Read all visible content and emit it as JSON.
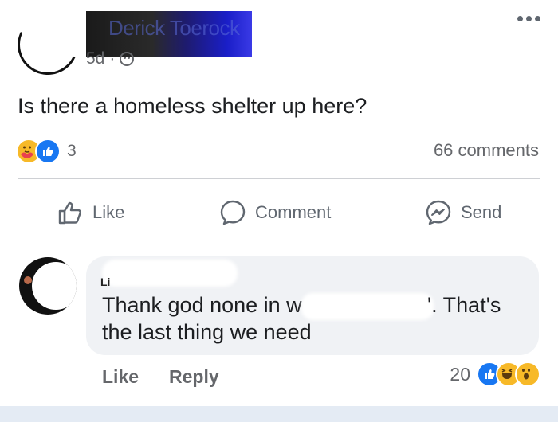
{
  "post": {
    "author": "Derick Toerock",
    "time": "5d",
    "separator": "·",
    "text": "Is there a homeless shelter up here?",
    "reaction_count": "3",
    "comments_label": "66 comments"
  },
  "actions": {
    "like": "Like",
    "comment": "Comment",
    "send": "Send"
  },
  "comment": {
    "author_visible": "Li",
    "text_part1": "Thank god none in w",
    "text_part2": "'. That's",
    "text_line2": "the last thing we need",
    "like_label": "Like",
    "reply_label": "Reply",
    "reaction_count": "20"
  },
  "colors": {
    "like_blue": "#1877f2",
    "emoji_yellow": "#f7b928",
    "muted_text": "#65676b",
    "bubble_bg": "#f0f2f5"
  },
  "icons": {
    "post_reactions": [
      "care-emoji-icon",
      "like-reaction-icon"
    ],
    "comment_reactions": [
      "like-reaction-icon",
      "haha-emoji-icon",
      "wow-emoji-icon"
    ]
  }
}
